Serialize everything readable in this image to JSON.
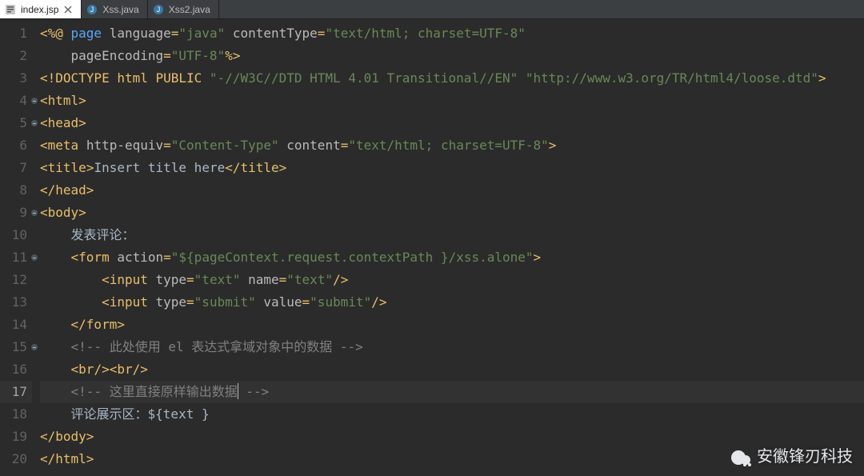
{
  "tabs": [
    {
      "label": "index.jsp",
      "icon": "jsp",
      "active": true,
      "closeable": true
    },
    {
      "label": "Xss.java",
      "icon": "java",
      "active": false,
      "closeable": false
    },
    {
      "label": "Xss2.java",
      "icon": "java",
      "active": false,
      "closeable": false
    }
  ],
  "gutter": {
    "lines": [
      1,
      2,
      3,
      4,
      5,
      6,
      7,
      8,
      9,
      10,
      11,
      12,
      13,
      14,
      15,
      16,
      17,
      18,
      19,
      20
    ],
    "fold_lines": [
      4,
      5,
      9,
      11,
      15
    ],
    "highlight_line": 17
  },
  "code_lines": [
    {
      "n": 1,
      "tokens": [
        {
          "cls": "c-punc",
          "t": "<%@ "
        },
        {
          "cls": "c-kw",
          "t": "page"
        },
        {
          "cls": "c-attr",
          "t": " language"
        },
        {
          "cls": "c-punc",
          "t": "="
        },
        {
          "cls": "c-str",
          "t": "\"java\""
        },
        {
          "cls": "c-attr",
          "t": " contentType"
        },
        {
          "cls": "c-punc",
          "t": "="
        },
        {
          "cls": "c-str",
          "t": "\"text/html; charset=UTF-8\""
        }
      ]
    },
    {
      "n": 2,
      "tokens": [
        {
          "cls": "c-text",
          "t": "    "
        },
        {
          "cls": "c-attr",
          "t": "pageEncoding"
        },
        {
          "cls": "c-punc",
          "t": "="
        },
        {
          "cls": "c-str",
          "t": "\"UTF-8\""
        },
        {
          "cls": "c-punc",
          "t": "%>"
        }
      ]
    },
    {
      "n": 3,
      "tokens": [
        {
          "cls": "c-punc",
          "t": "<!"
        },
        {
          "cls": "c-tag",
          "t": "DOCTYPE html PUBLIC "
        },
        {
          "cls": "c-str",
          "t": "\"-//W3C//DTD HTML 4.01 Transitional//EN\" \"http://www.w3.org/TR/html4/loose.dtd\""
        },
        {
          "cls": "c-punc",
          "t": ">"
        }
      ]
    },
    {
      "n": 4,
      "tokens": [
        {
          "cls": "c-punc",
          "t": "<"
        },
        {
          "cls": "c-tag",
          "t": "html"
        },
        {
          "cls": "c-punc",
          "t": ">"
        }
      ]
    },
    {
      "n": 5,
      "tokens": [
        {
          "cls": "c-punc",
          "t": "<"
        },
        {
          "cls": "c-tag",
          "t": "head"
        },
        {
          "cls": "c-punc",
          "t": ">"
        }
      ]
    },
    {
      "n": 6,
      "tokens": [
        {
          "cls": "c-punc",
          "t": "<"
        },
        {
          "cls": "c-tag",
          "t": "meta "
        },
        {
          "cls": "c-attr",
          "t": "http-equiv"
        },
        {
          "cls": "c-punc",
          "t": "="
        },
        {
          "cls": "c-str",
          "t": "\"Content-Type\""
        },
        {
          "cls": "c-attr",
          "t": " content"
        },
        {
          "cls": "c-punc",
          "t": "="
        },
        {
          "cls": "c-str",
          "t": "\"text/html; charset=UTF-8\""
        },
        {
          "cls": "c-punc",
          "t": ">"
        }
      ]
    },
    {
      "n": 7,
      "tokens": [
        {
          "cls": "c-punc",
          "t": "<"
        },
        {
          "cls": "c-tag",
          "t": "title"
        },
        {
          "cls": "c-punc",
          "t": ">"
        },
        {
          "cls": "c-text",
          "t": "Insert title here"
        },
        {
          "cls": "c-punc",
          "t": "</"
        },
        {
          "cls": "c-tag",
          "t": "title"
        },
        {
          "cls": "c-punc",
          "t": ">"
        }
      ]
    },
    {
      "n": 8,
      "tokens": [
        {
          "cls": "c-punc",
          "t": "</"
        },
        {
          "cls": "c-tag",
          "t": "head"
        },
        {
          "cls": "c-punc",
          "t": ">"
        }
      ]
    },
    {
      "n": 9,
      "tokens": [
        {
          "cls": "c-punc",
          "t": "<"
        },
        {
          "cls": "c-tag",
          "t": "body"
        },
        {
          "cls": "c-punc",
          "t": ">"
        }
      ]
    },
    {
      "n": 10,
      "tokens": [
        {
          "cls": "c-text",
          "t": "    发表评论："
        }
      ]
    },
    {
      "n": 11,
      "tokens": [
        {
          "cls": "c-text",
          "t": "    "
        },
        {
          "cls": "c-punc",
          "t": "<"
        },
        {
          "cls": "c-tag",
          "t": "form "
        },
        {
          "cls": "c-attr",
          "t": "action"
        },
        {
          "cls": "c-punc",
          "t": "="
        },
        {
          "cls": "c-str",
          "t": "\"${pageContext.request.contextPath }/xss.alone\""
        },
        {
          "cls": "c-punc",
          "t": ">"
        }
      ]
    },
    {
      "n": 12,
      "tokens": [
        {
          "cls": "c-text",
          "t": "        "
        },
        {
          "cls": "c-punc",
          "t": "<"
        },
        {
          "cls": "c-tag",
          "t": "input "
        },
        {
          "cls": "c-attr",
          "t": "type"
        },
        {
          "cls": "c-punc",
          "t": "="
        },
        {
          "cls": "c-str",
          "t": "\"text\""
        },
        {
          "cls": "c-attr",
          "t": " name"
        },
        {
          "cls": "c-punc",
          "t": "="
        },
        {
          "cls": "c-str",
          "t": "\"text\""
        },
        {
          "cls": "c-punc",
          "t": "/>"
        }
      ]
    },
    {
      "n": 13,
      "tokens": [
        {
          "cls": "c-text",
          "t": "        "
        },
        {
          "cls": "c-punc",
          "t": "<"
        },
        {
          "cls": "c-tag",
          "t": "input "
        },
        {
          "cls": "c-attr",
          "t": "type"
        },
        {
          "cls": "c-punc",
          "t": "="
        },
        {
          "cls": "c-str",
          "t": "\"submit\""
        },
        {
          "cls": "c-attr",
          "t": " value"
        },
        {
          "cls": "c-punc",
          "t": "="
        },
        {
          "cls": "c-str",
          "t": "\"submit\""
        },
        {
          "cls": "c-punc",
          "t": "/>"
        }
      ]
    },
    {
      "n": 14,
      "tokens": [
        {
          "cls": "c-text",
          "t": "    "
        },
        {
          "cls": "c-punc",
          "t": "</"
        },
        {
          "cls": "c-tag",
          "t": "form"
        },
        {
          "cls": "c-punc",
          "t": ">"
        }
      ]
    },
    {
      "n": 15,
      "tokens": [
        {
          "cls": "c-text",
          "t": "    "
        },
        {
          "cls": "c-comment",
          "t": "<!-- 此处使用 el 表达式拿域对象中的数据 -->"
        }
      ]
    },
    {
      "n": 16,
      "tokens": [
        {
          "cls": "c-text",
          "t": "    "
        },
        {
          "cls": "c-punc",
          "t": "<"
        },
        {
          "cls": "c-tag",
          "t": "br"
        },
        {
          "cls": "c-punc",
          "t": "/><"
        },
        {
          "cls": "c-tag",
          "t": "br"
        },
        {
          "cls": "c-punc",
          "t": "/>"
        }
      ]
    },
    {
      "n": 17,
      "hl": true,
      "tokens": [
        {
          "cls": "c-text",
          "t": "    "
        },
        {
          "cls": "c-comment",
          "t": "<!-- 这里直接原样输出数据"
        },
        {
          "cls": "caret-marker",
          "t": ""
        },
        {
          "cls": "c-comment",
          "t": " -->"
        }
      ]
    },
    {
      "n": 18,
      "tokens": [
        {
          "cls": "c-text",
          "t": "    评论展示区：${text }"
        }
      ]
    },
    {
      "n": 19,
      "tokens": [
        {
          "cls": "c-punc",
          "t": "</"
        },
        {
          "cls": "c-tag",
          "t": "body"
        },
        {
          "cls": "c-punc",
          "t": ">"
        }
      ]
    },
    {
      "n": 20,
      "tokens": [
        {
          "cls": "c-punc",
          "t": "</"
        },
        {
          "cls": "c-tag",
          "t": "html"
        },
        {
          "cls": "c-punc",
          "t": ">"
        }
      ]
    }
  ],
  "watermark": {
    "text": "安徽锋刃科技"
  }
}
